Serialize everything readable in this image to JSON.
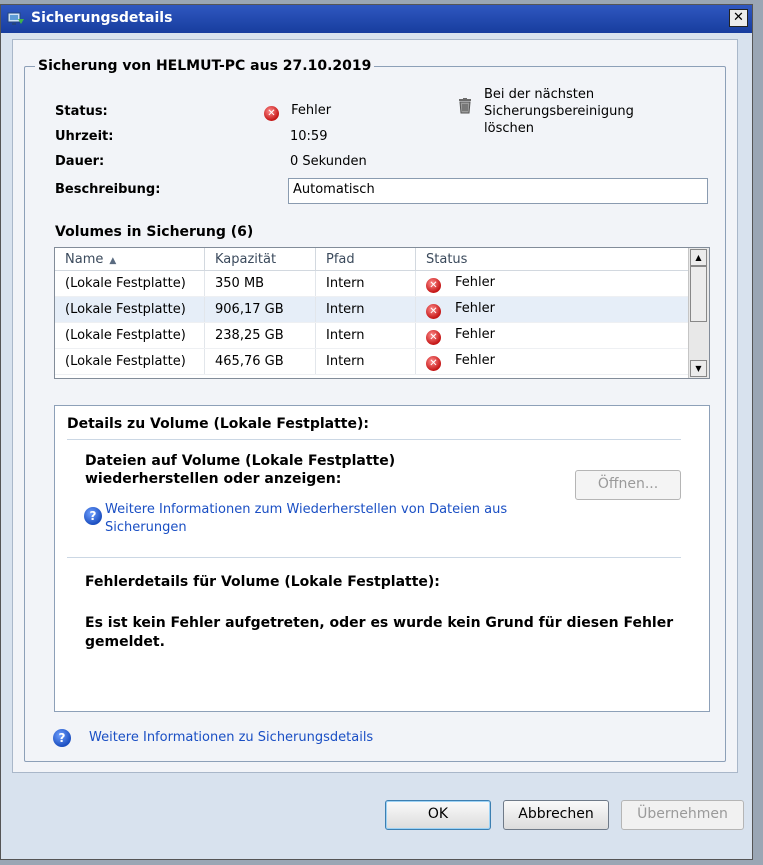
{
  "window": {
    "title": "Sicherungsdetails",
    "close_symbol": "✕"
  },
  "backup": {
    "group_title": "Sicherung von HELMUT-PC aus 27.10.2019",
    "status_label": "Status:",
    "status_value": "Fehler",
    "time_label": "Uhrzeit:",
    "time_value": "10:59",
    "duration_label": "Dauer:",
    "duration_value": "0 Sekunden",
    "description_label": "Beschreibung:",
    "description_value": "Automatisch",
    "delete_text": "Bei der nächsten Sicherungsbereinigung löschen"
  },
  "volumes": {
    "title": "Volumes in Sicherung (6)",
    "columns": [
      "Name",
      "Kapazität",
      "Pfad",
      "Status"
    ],
    "rows": [
      {
        "name": "(Lokale Festplatte)",
        "capacity": "350 MB",
        "path": "Intern",
        "status": "Fehler"
      },
      {
        "name": "(Lokale Festplatte)",
        "capacity": "906,17 GB",
        "path": "Intern",
        "status": "Fehler"
      },
      {
        "name": "(Lokale Festplatte)",
        "capacity": "238,25 GB",
        "path": "Intern",
        "status": "Fehler"
      },
      {
        "name": "(Lokale Festplatte)",
        "capacity": "465,76 GB",
        "path": "Intern",
        "status": "Fehler"
      }
    ]
  },
  "details": {
    "title": "Details zu Volume  (Lokale Festplatte):",
    "files_title": "Dateien auf Volume  (Lokale Festplatte) wiederherstellen oder anzeigen:",
    "open_button": "Öffnen...",
    "restore_link": "Weitere Informationen zum Wiederherstellen von Dateien aus Sicherungen",
    "error_title": "Fehlerdetails für Volume  (Lokale Festplatte):",
    "error_message": "Es ist kein Fehler aufgetreten, oder es wurde kein Grund für diesen Fehler gemeldet."
  },
  "help_link": "Weitere Informationen zu Sicherungsdetails",
  "buttons": {
    "ok": "OK",
    "cancel": "Abbrechen",
    "apply": "Übernehmen"
  }
}
